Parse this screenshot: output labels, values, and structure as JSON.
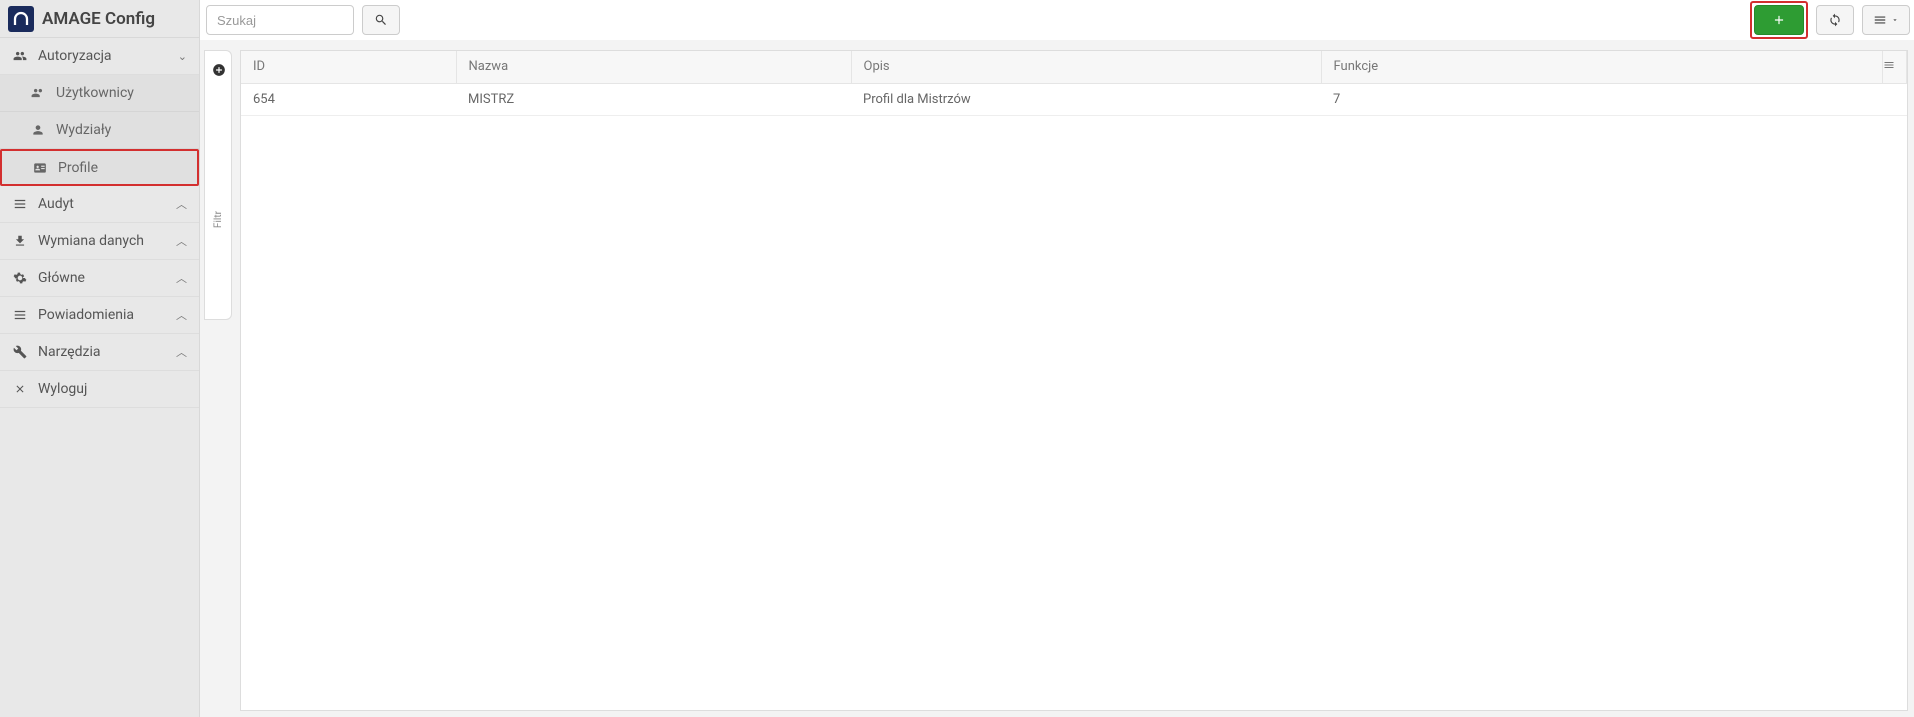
{
  "brand": {
    "title": "AMAGE Config"
  },
  "search": {
    "placeholder": "Szukaj"
  },
  "sidebar": {
    "sections": [
      {
        "label": "Autoryzacja",
        "expanded": true,
        "icon": "users",
        "items": [
          {
            "label": "Użytkownicy",
            "icon": "users"
          },
          {
            "label": "Wydziały",
            "icon": "user"
          },
          {
            "label": "Profile",
            "icon": "id-card",
            "highlighted": true
          }
        ]
      },
      {
        "label": "Audyt",
        "expanded": false,
        "icon": "list"
      },
      {
        "label": "Wymiana danych",
        "expanded": false,
        "icon": "download"
      },
      {
        "label": "Główne",
        "expanded": false,
        "icon": "gear"
      },
      {
        "label": "Powiadomienia",
        "expanded": false,
        "icon": "list"
      },
      {
        "label": "Narzędzia",
        "expanded": false,
        "icon": "tools"
      },
      {
        "label": "Wyloguj",
        "expanded": null,
        "icon": "x"
      }
    ]
  },
  "filter": {
    "label": "Filtr"
  },
  "table": {
    "columns": [
      {
        "key": "id",
        "label": "ID"
      },
      {
        "key": "name",
        "label": "Nazwa"
      },
      {
        "key": "desc",
        "label": "Opis"
      },
      {
        "key": "fn",
        "label": "Funkcje"
      }
    ],
    "rows": [
      {
        "id": "654",
        "name": "MISTRZ",
        "desc": "Profil dla Mistrzów",
        "fn": "7"
      }
    ]
  }
}
